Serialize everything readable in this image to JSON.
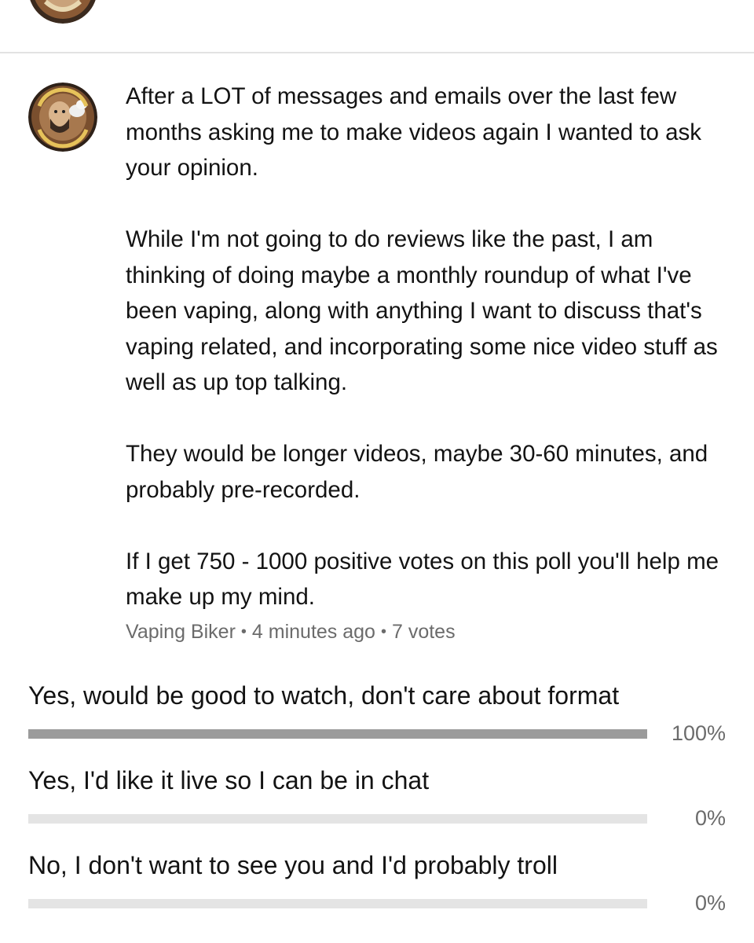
{
  "post": {
    "paragraphs": [
      "After a LOT of messages and emails over the last few months asking me to make videos again I wanted to ask your opinion.",
      "While I'm not going to do reviews like the past, I am thinking of doing maybe a monthly roundup of what I've been vaping, along with anything I want to discuss that's vaping related, and incorporating some nice video stuff as well as up top talking.",
      "They would be longer videos, maybe 30-60 minutes, and probably pre-recorded.",
      "If I get 750 - 1000 positive votes on this poll you'll help me make up my mind."
    ],
    "author": "Vaping Biker",
    "time": "4 minutes ago",
    "votes": "7 votes",
    "avatar_icon": "vaping-biker-logo"
  },
  "poll": {
    "options": [
      {
        "label": "Yes, would be good to watch, don't care about format",
        "percent_text": "100%",
        "fraction": 1.0
      },
      {
        "label": "Yes, I'd like it live so I can be in chat",
        "percent_text": "0%",
        "fraction": 0.0
      },
      {
        "label": "No, I don't want to see you and I'd probably troll",
        "percent_text": "0%",
        "fraction": 0.0
      }
    ]
  },
  "colors": {
    "bar_filled": "#9b9b9b",
    "bar_track": "#e4e4e4",
    "meta_text": "#6b6b6b"
  }
}
